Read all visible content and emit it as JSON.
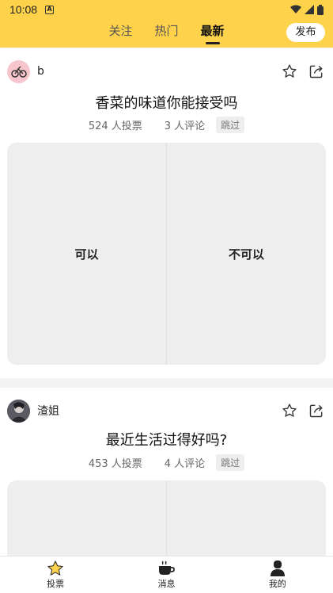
{
  "status_bar": {
    "time": "10:08",
    "notification_icon": "A"
  },
  "header": {
    "tabs": [
      {
        "label": "关注",
        "active": false
      },
      {
        "label": "热门",
        "active": false
      },
      {
        "label": "最新",
        "active": true
      }
    ],
    "publish_label": "发布"
  },
  "posts": [
    {
      "avatar_icon": "cartoon-bike-avatar",
      "username": "b",
      "question": "香菜的味道你能接受吗",
      "vote_count": "524 人投票",
      "comment_count": "3 人评论",
      "skip_label": "跳过",
      "options": [
        "可以",
        "不可以"
      ]
    },
    {
      "avatar_icon": "photo-avatar",
      "username": "渣姐",
      "question": "最近生活过得好吗?",
      "vote_count": "453 人投票",
      "comment_count": "4 人评论",
      "skip_label": "跳过",
      "options": [
        "",
        ""
      ]
    }
  ],
  "bottom_nav": [
    {
      "label": "投票",
      "icon": "star-icon",
      "active": true
    },
    {
      "label": "消息",
      "icon": "coffee-cup-icon",
      "active": false
    },
    {
      "label": "我的",
      "icon": "user-icon",
      "active": false
    }
  ],
  "colors": {
    "accent": "#fed24a",
    "option_bg": "#eeeeee",
    "star_active": "#fed24a"
  }
}
